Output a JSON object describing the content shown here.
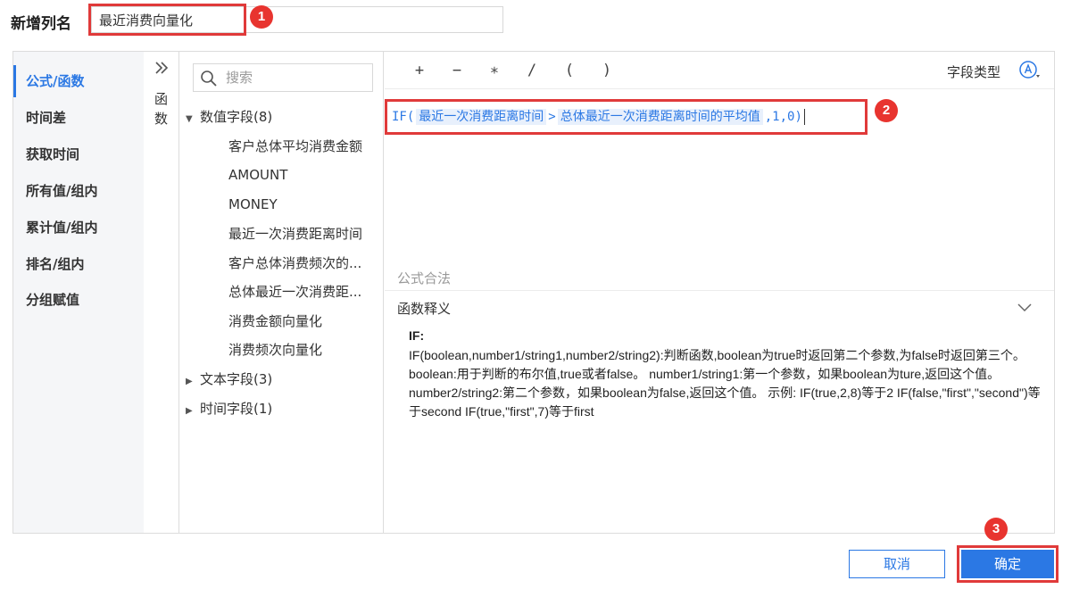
{
  "header": {
    "label": "新增列名",
    "name_value": "最近消费向量化"
  },
  "badges": [
    "1",
    "2",
    "3"
  ],
  "categories": [
    {
      "label": "公式/函数",
      "active": true
    },
    {
      "label": "时间差",
      "active": false
    },
    {
      "label": "获取时间",
      "active": false
    },
    {
      "label": "所有值/组内",
      "active": false
    },
    {
      "label": "累计值/组内",
      "active": false
    },
    {
      "label": "排名/组内",
      "active": false
    },
    {
      "label": "分组赋值",
      "active": false
    }
  ],
  "function_panel": {
    "label": "函数"
  },
  "search": {
    "placeholder": "搜索"
  },
  "field_groups": [
    {
      "label": "数值字段(8)",
      "expanded": true,
      "fields": [
        "客户总体平均消费金额",
        "AMOUNT",
        "MONEY",
        "最近一次消费距离时间",
        "客户总体消费频次的...",
        "总体最近一次消费距...",
        "消费金额向量化",
        "消费频次向量化"
      ]
    },
    {
      "label": "文本字段(3)",
      "expanded": false,
      "fields": []
    },
    {
      "label": "时间字段(1)",
      "expanded": false,
      "fields": []
    }
  ],
  "toolbar": {
    "operators": [
      "+",
      "−",
      "∗",
      "/",
      "(",
      ")"
    ],
    "field_type_label": "字段类型",
    "field_type_icon": "text-type-icon"
  },
  "formula": {
    "prefix": "IF(",
    "ref1": "最近一次消费距离时间",
    "operator": ">",
    "ref2": "总体最近一次消费距离时间的平均值",
    "suffix": ",1,0)"
  },
  "validation": "公式合法",
  "func_desc": {
    "title": "函数释义",
    "name": "IF:",
    "body": "IF(boolean,number1/string1,number2/string2):判断函数,boolean为true时返回第二个参数,为false时返回第三个。 boolean:用于判断的布尔值,true或者false。 number1/string1:第一个参数，如果boolean为ture,返回这个值。 number2/string2:第二个参数，如果boolean为false,返回这个值。 示例: IF(true,2,8)等于2 IF(false,\"first\",\"second\")等于second IF(true,\"first\",7)等于first"
  },
  "buttons": {
    "cancel": "取消",
    "ok": "确定"
  },
  "colors": {
    "accent": "#2b78e4",
    "highlight": "#e03a3a",
    "badge": "#e8342f"
  }
}
